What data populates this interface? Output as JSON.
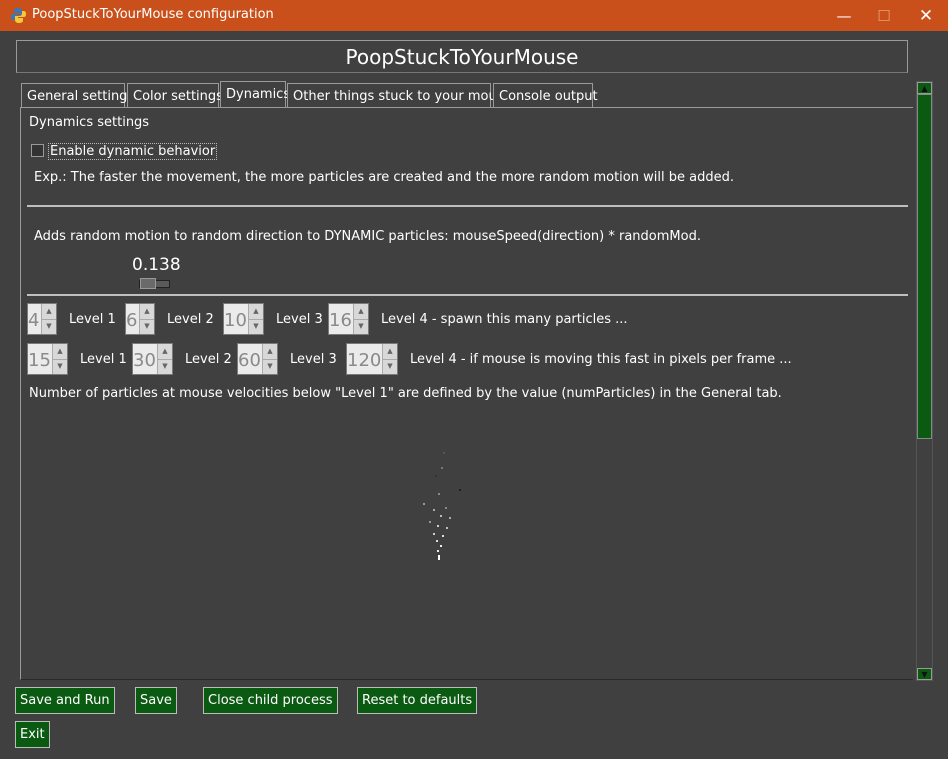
{
  "window": {
    "title": "PoopStuckToYourMouse configuration",
    "minimize_glyph": "—",
    "maximize_glyph": "☐",
    "close_glyph": "✕"
  },
  "header": {
    "title": "PoopStuckToYourMouse"
  },
  "tabs": [
    {
      "label": "General settings"
    },
    {
      "label": "Color settings"
    },
    {
      "label": "Dynamics"
    },
    {
      "label": "Other things stuck to your mouse"
    },
    {
      "label": "Console output"
    }
  ],
  "active_tab": "Dynamics",
  "dynamics": {
    "section_title": "Dynamics settings",
    "enable_label": "Enable dynamic behavior",
    "enable_checked": false,
    "explanation": "Exp.: The faster the movement, the more particles are created and the more random motion will be added.",
    "random_motion_text": "Adds random motion to random direction to DYNAMIC particles: mouseSpeed(direction) * randomMod.",
    "random_mod_value": "0.138",
    "particle_row": {
      "values": [
        "4",
        "6",
        "10",
        "16"
      ],
      "labels": [
        "Level 1",
        "Level 2",
        "Level 3",
        "Level 4 - spawn this many particles ..."
      ]
    },
    "speed_row": {
      "values": [
        "15",
        "30",
        "60",
        "120"
      ],
      "labels": [
        "Level 1",
        "Level 2",
        "Level 3",
        "Level 4 - if mouse is moving this fast in pixels per frame ..."
      ]
    },
    "footnote": "Number of particles at mouse velocities below \"Level 1\" are defined by the value (numParticles) in the General tab."
  },
  "buttons": {
    "save_and_run": "Save and Run",
    "save": "Save",
    "close_child": "Close child process",
    "reset": "Reset to defaults",
    "exit": "Exit"
  },
  "colors": {
    "titlebar": "#c9501a",
    "background": "#404040",
    "button_green": "#0b5a12"
  }
}
